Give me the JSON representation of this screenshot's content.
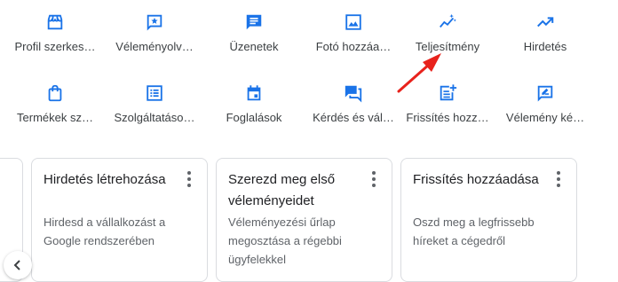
{
  "actions_row1": [
    {
      "label": "Profil szerkes…",
      "icon": "storefront-icon"
    },
    {
      "label": "Véleményolv…",
      "icon": "review-icon"
    },
    {
      "label": "Üzenetek",
      "icon": "message-icon"
    },
    {
      "label": "Fotó hozzáa…",
      "icon": "photo-icon"
    },
    {
      "label": "Teljesítmény",
      "icon": "performance-icon"
    },
    {
      "label": "Hirdetés",
      "icon": "trending-up-icon"
    }
  ],
  "actions_row2": [
    {
      "label": "Termékek sz…",
      "icon": "shopping-bag-icon"
    },
    {
      "label": "Szolgáltatáso…",
      "icon": "list-icon"
    },
    {
      "label": "Foglalások",
      "icon": "calendar-icon"
    },
    {
      "label": "Kérdés és vál…",
      "icon": "forum-icon"
    },
    {
      "label": "Frissítés hozz…",
      "icon": "post-add-icon"
    },
    {
      "label": "Vélemény ké…",
      "icon": "rate-review-icon"
    }
  ],
  "cards": [
    {
      "title": "Hirdetés létrehozása",
      "description": "Hirdesd a vállalkozást a Google rendszerében"
    },
    {
      "title": "Szerezd meg első véleményeidet",
      "description": "Véleményezési űrlap megosztása a régebbi ügyfelekkel"
    },
    {
      "title": "Frissítés hozzáadása",
      "description": "Oszd meg a legfrissebb híreket a cégedről"
    }
  ],
  "colors": {
    "accent": "#1a73e8",
    "annotation_arrow": "#e8221c"
  },
  "nav": {
    "prev_icon": "chevron-left-icon"
  }
}
